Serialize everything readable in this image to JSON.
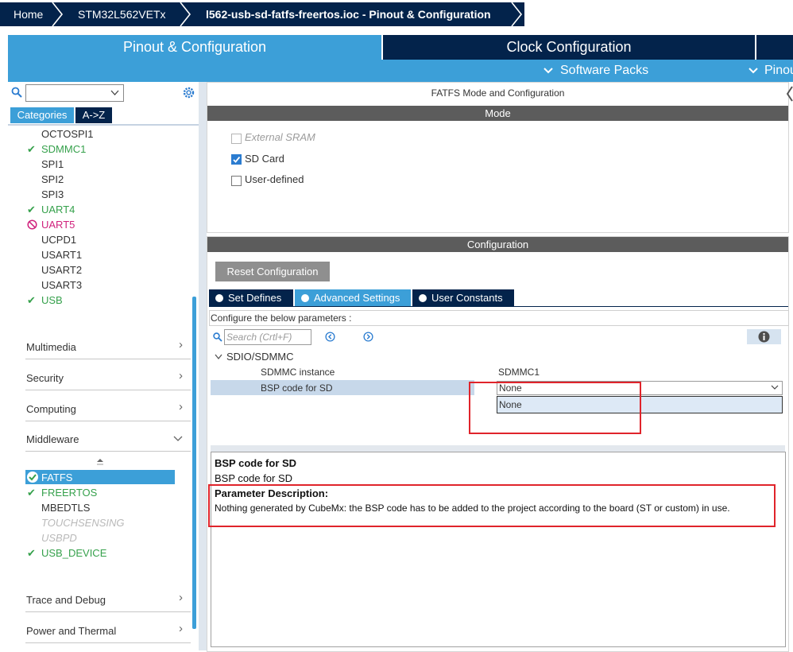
{
  "breadcrumb": {
    "home": "Home",
    "device": "STM32L562VETx",
    "file": "l562-usb-sd-fatfs-freertos.ioc - Pinout & Configuration"
  },
  "tabs": {
    "pinout": "Pinout & Configuration",
    "clock": "Clock Configuration",
    "software_packs": "Software Packs",
    "pinout_cut": "Pinou"
  },
  "sidebar": {
    "search_value": "",
    "view_tabs": [
      "Categories",
      "A->Z"
    ],
    "connectivity_items": [
      {
        "label": "OCTOSPI1",
        "state": "none"
      },
      {
        "label": "SDMMC1",
        "state": "ok"
      },
      {
        "label": "SPI1",
        "state": "none"
      },
      {
        "label": "SPI2",
        "state": "none"
      },
      {
        "label": "SPI3",
        "state": "none"
      },
      {
        "label": "UART4",
        "state": "ok"
      },
      {
        "label": "UART5",
        "state": "conflict"
      },
      {
        "label": "UCPD1",
        "state": "none"
      },
      {
        "label": "USART1",
        "state": "none"
      },
      {
        "label": "USART2",
        "state": "none"
      },
      {
        "label": "USART3",
        "state": "none"
      },
      {
        "label": "USB",
        "state": "ok"
      }
    ],
    "sections": [
      "Multimedia",
      "Security",
      "Computing",
      "Middleware"
    ],
    "middleware_items": [
      {
        "label": "FATFS",
        "state": "selected"
      },
      {
        "label": "FREERTOS",
        "state": "ok"
      },
      {
        "label": "MBEDTLS",
        "state": "none"
      },
      {
        "label": "TOUCHSENSING",
        "state": "disabled"
      },
      {
        "label": "USBPD",
        "state": "disabled"
      },
      {
        "label": "USB_DEVICE",
        "state": "ok"
      }
    ],
    "bottom_sections": [
      "Trace and Debug",
      "Power and Thermal"
    ]
  },
  "mode_panel": {
    "title": "FATFS Mode and Configuration",
    "mode_header": "Mode",
    "options": [
      {
        "label": "External SRAM",
        "checked": false,
        "enabled": false
      },
      {
        "label": "SD Card",
        "checked": true,
        "enabled": true
      },
      {
        "label": "User-defined",
        "checked": false,
        "enabled": true
      }
    ]
  },
  "config_panel": {
    "header": "Configuration",
    "reset_button": "Reset Configuration",
    "tabs": [
      "Set Defines",
      "Advanced Settings",
      "User Constants"
    ],
    "instruction": "Configure the below parameters :",
    "search_placeholder": "Search (Crtl+F)",
    "group": "SDIO/SDMMC",
    "params": [
      {
        "name": "SDMMC instance",
        "value": "SDMMC1"
      },
      {
        "name": "BSP code for SD",
        "value": "None"
      }
    ],
    "dropdown_option": "None"
  },
  "description": {
    "title": "BSP code for SD",
    "subtitle": "BSP code for SD",
    "param_header": "Parameter Description:",
    "text": "Nothing generated by CubeMx: the BSP code has to be added to the project according to the board (ST or custom) in use."
  },
  "colors": {
    "breadcrumb_bg": "#03234b",
    "tab_active": "#3c9fd8",
    "tab_inactive": "#03234b",
    "ok_green": "#36a14c",
    "conflict_pink": "#d0227d",
    "highlight_red": "#e0242b",
    "selected_blue": "#3c9fd8"
  }
}
